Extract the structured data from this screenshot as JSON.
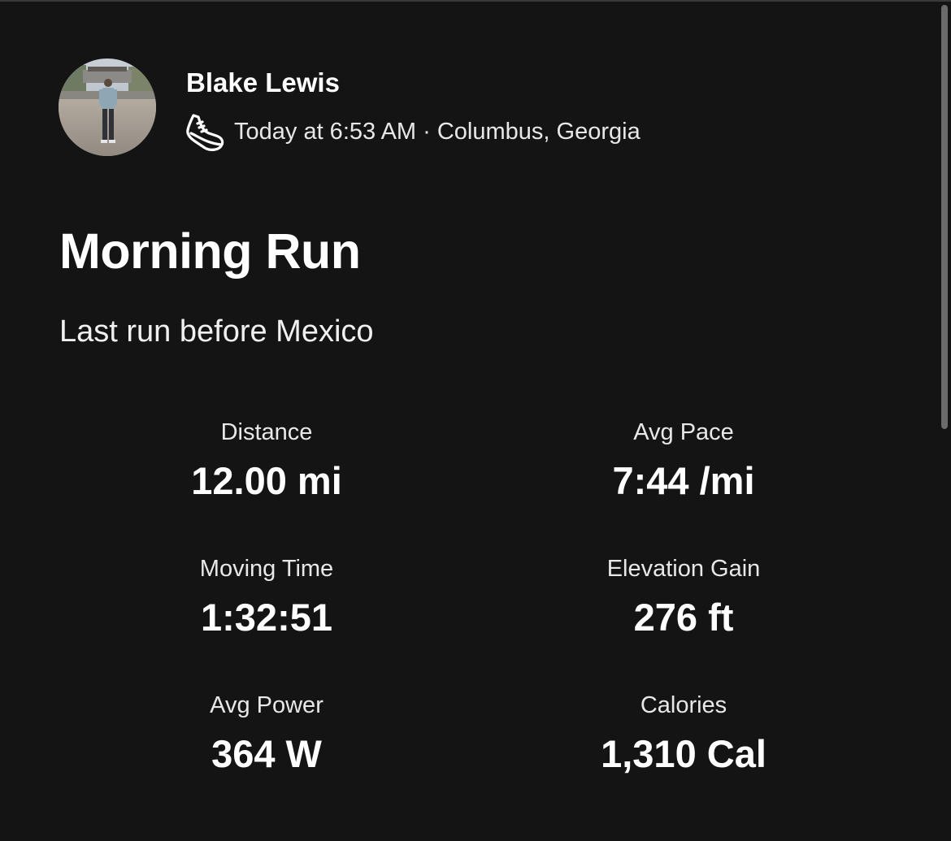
{
  "athlete": {
    "name": "Blake Lewis",
    "activity_icon": "running-shoe-icon",
    "meta": "Today at 6:53 AM · Columbus, Georgia"
  },
  "activity": {
    "title": "Morning Run",
    "description": "Last run before Mexico"
  },
  "stats": {
    "distance": {
      "label": "Distance",
      "value": "12.00 mi"
    },
    "avg_pace": {
      "label": "Avg Pace",
      "value": "7:44 /mi"
    },
    "moving_time": {
      "label": "Moving Time",
      "value": "1:32:51"
    },
    "elevation_gain": {
      "label": "Elevation Gain",
      "value": "276 ft"
    },
    "avg_power": {
      "label": "Avg Power",
      "value": "364 W"
    },
    "calories": {
      "label": "Calories",
      "value": "1,310 Cal"
    }
  },
  "colors": {
    "background": "#141414",
    "text_primary": "#ffffff",
    "text_secondary": "#e8e8e8",
    "scrollbar_thumb": "#6b6b6b"
  }
}
